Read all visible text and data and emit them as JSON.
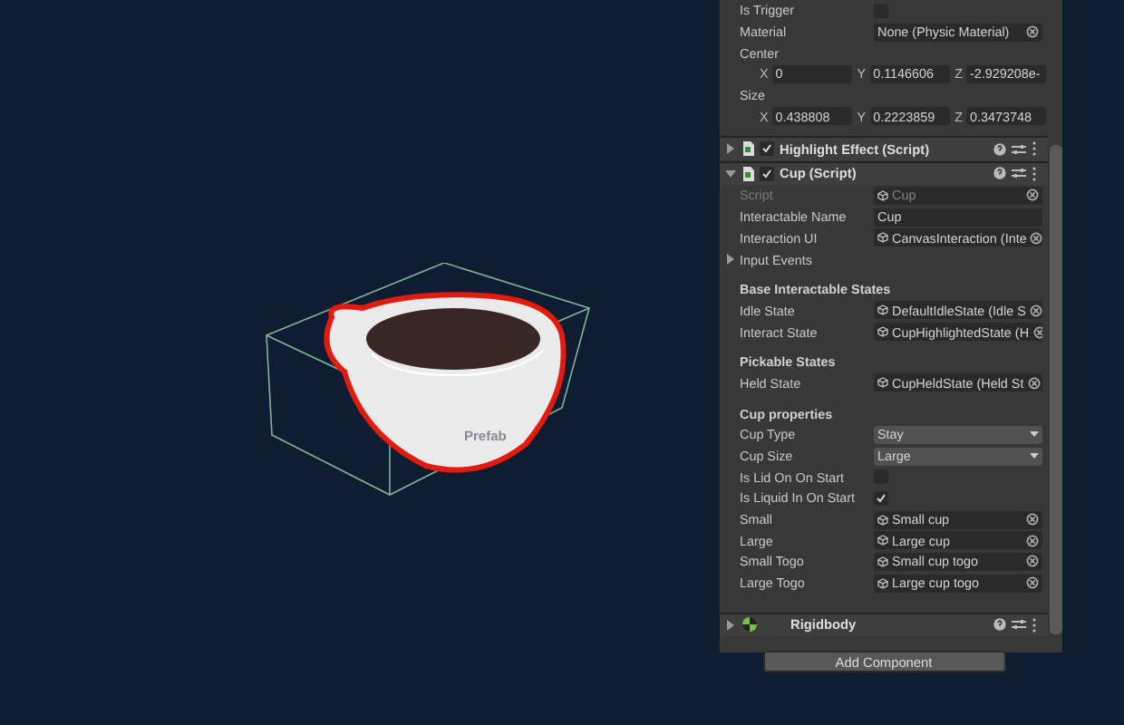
{
  "scene": {
    "label": "Prefab"
  },
  "inspector": {
    "top_rows": [
      {
        "kind": "checkbox",
        "label": "Is Trigger",
        "checked": false
      },
      {
        "kind": "object",
        "label": "Material",
        "value": "None (Physic Material)"
      },
      {
        "kind": "heading",
        "label": "Center"
      },
      {
        "kind": "vector",
        "values": [
          {
            "axis": "X",
            "value": "0"
          },
          {
            "axis": "Y",
            "value": "0.1146606"
          },
          {
            "axis": "Z",
            "value": "-2.929208e-"
          }
        ]
      },
      {
        "kind": "heading",
        "label": "Size"
      },
      {
        "kind": "vector",
        "values": [
          {
            "axis": "X",
            "value": "0.438808"
          },
          {
            "axis": "Y",
            "value": "0.2223859"
          },
          {
            "axis": "Z",
            "value": "0.3473748"
          }
        ]
      }
    ],
    "components": [
      {
        "kind": "script",
        "title": "Highlight Effect (Script)",
        "expanded": false,
        "enabled": true
      },
      {
        "kind": "script",
        "title": "Cup (Script)",
        "expanded": true,
        "enabled": true,
        "rows": [
          {
            "kind": "object",
            "label": "Script",
            "value": "Cup",
            "disabled": true
          },
          {
            "kind": "text",
            "label": "Interactable Name",
            "value": "Cup"
          },
          {
            "kind": "object",
            "label": "Interaction UI",
            "value": "CanvasInteraction (Inte"
          },
          {
            "kind": "foldout",
            "label": "Input Events",
            "expanded": false
          },
          {
            "kind": "section",
            "label": "Base Interactable States"
          },
          {
            "kind": "object",
            "label": "Idle State",
            "value": "DefaultIdleState (Idle S"
          },
          {
            "kind": "object",
            "label": "Interact State",
            "value": "CupHighlightedState (H"
          },
          {
            "kind": "section",
            "label": "Pickable States"
          },
          {
            "kind": "object",
            "label": "Held State",
            "value": "CupHeldState (Held St"
          },
          {
            "kind": "section",
            "label": "Cup properties"
          },
          {
            "kind": "dropdown",
            "label": "Cup Type",
            "value": "Stay"
          },
          {
            "kind": "dropdown",
            "label": "Cup Size",
            "value": "Large"
          },
          {
            "kind": "checkbox",
            "label": "Is Lid On On Start",
            "checked": false
          },
          {
            "kind": "checkbox",
            "label": "Is Liquid In On Start",
            "checked": true
          },
          {
            "kind": "object",
            "label": "Small",
            "value": "Small cup"
          },
          {
            "kind": "object",
            "label": "Large",
            "value": "Large cup"
          },
          {
            "kind": "object",
            "label": "Small Togo",
            "value": "Small cup togo"
          },
          {
            "kind": "object",
            "label": "Large Togo",
            "value": "Large cup togo"
          }
        ]
      },
      {
        "kind": "physics",
        "title": "Rigidbody",
        "expanded": false
      }
    ],
    "add_button": "Add Component"
  }
}
